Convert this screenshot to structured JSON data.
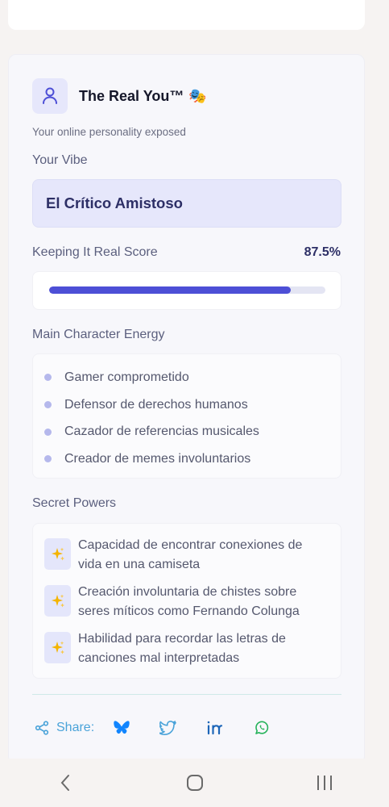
{
  "card": {
    "title": "The Real You™",
    "title_emoji": "🎭",
    "subtitle": "Your online personality exposed",
    "icon": "user-icon"
  },
  "vibe": {
    "label": "Your Vibe",
    "value": "El Crítico Amistoso"
  },
  "score": {
    "label": "Keeping It Real Score",
    "value_text": "87.5%",
    "value": 0.875
  },
  "energy": {
    "label": "Main Character Energy",
    "items": [
      "Gamer comprometido",
      "Defensor de derechos humanos",
      "Cazador de referencias musicales",
      "Creador de memes involuntarios"
    ]
  },
  "powers": {
    "label": "Secret Powers",
    "icon": "sparkles-icon",
    "items": [
      "Capacidad de encontrar conexiones de vida en una camiseta",
      "Creación involuntaria de chistes sobre seres míticos como Fernando Colunga",
      "Habilidad para recordar las letras de canciones mal interpretadas"
    ]
  },
  "share": {
    "label": "Share:",
    "targets": [
      "bluesky-icon",
      "twitter-icon",
      "linkedin-icon",
      "whatsapp-icon"
    ]
  },
  "colors": {
    "accent": "#4d4fd6",
    "share": "#4aa3d9",
    "bluesky": "#1185fe",
    "whatsapp": "#25b25a"
  },
  "navbar": {
    "buttons": [
      "back-icon",
      "home-icon",
      "recents-icon"
    ]
  }
}
